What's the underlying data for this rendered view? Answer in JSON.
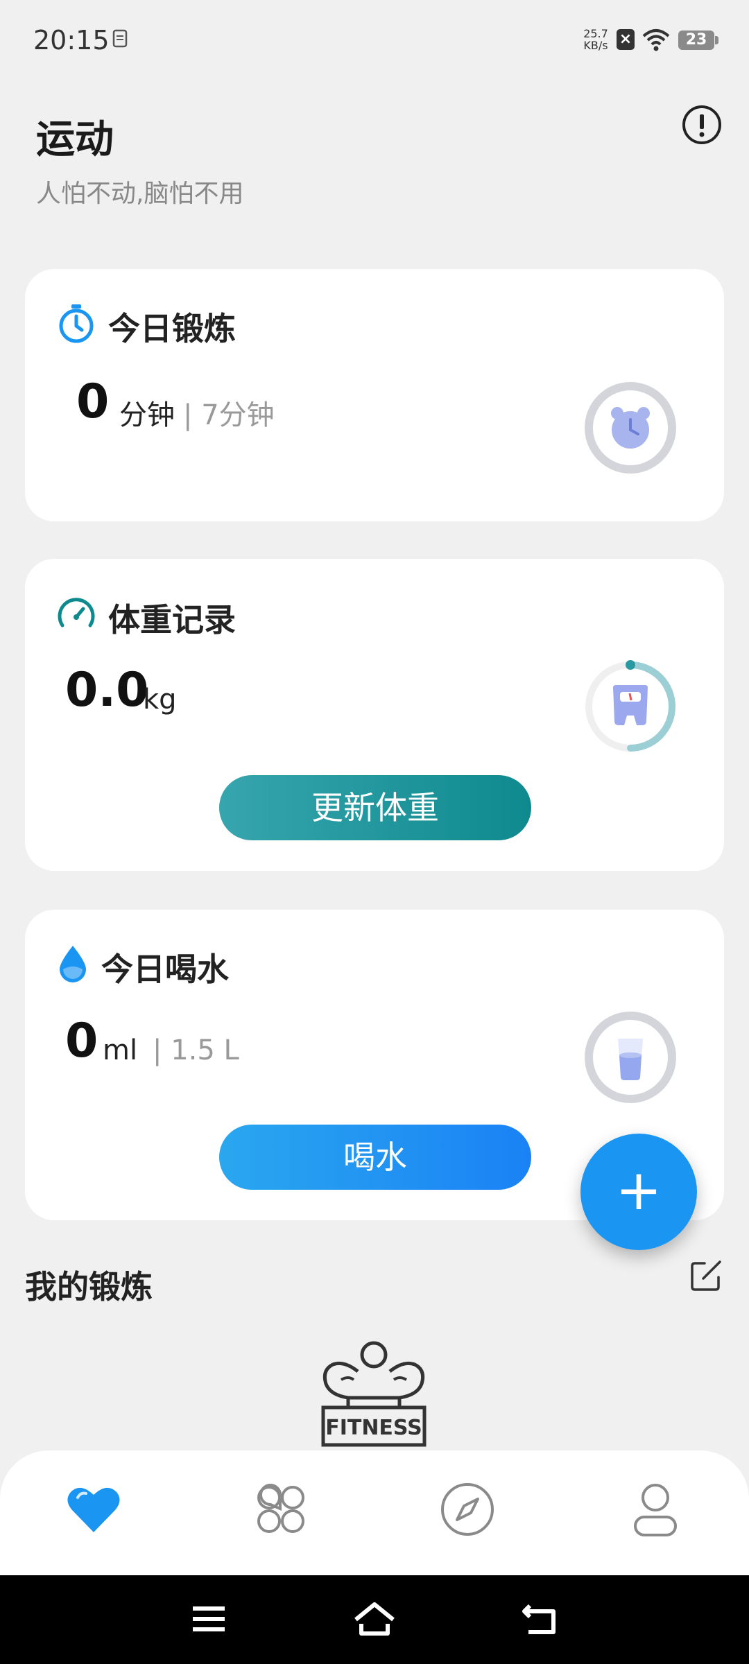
{
  "status_bar": {
    "time": "20:15",
    "net_speed_value": "25.7",
    "net_speed_unit": "KB/s",
    "battery": "23",
    "icons": [
      "document-icon",
      "x-box-icon",
      "wifi-icon",
      "battery-icon"
    ]
  },
  "header": {
    "title": "运动",
    "subtitle": "人怕不动,脑怕不用",
    "info_icon": "info-icon"
  },
  "exercise_card": {
    "title": "今日锻炼",
    "value": "0",
    "unit": "分钟",
    "goal": "| 7分钟",
    "icon": "timer-icon",
    "ring_icon": "alarm-clock-icon"
  },
  "weight_card": {
    "title": "体重记录",
    "value": "0.0",
    "unit": "kg",
    "button": "更新体重",
    "icon": "gauge-icon",
    "ring_icon": "scale-icon",
    "ring_progress": 0.5
  },
  "water_card": {
    "title": "今日喝水",
    "value": "0",
    "unit": "ml",
    "goal": "| 1.5 L",
    "button": "喝水",
    "icon": "water-drop-icon",
    "ring_icon": "glass-icon"
  },
  "fab": {
    "label": "+"
  },
  "my_exercise": {
    "title": "我的锻炼",
    "logo_text": "FITNESS"
  },
  "bottom_nav": {
    "items": [
      "heart-icon",
      "apps-icon",
      "compass-icon",
      "profile-icon"
    ],
    "active": 0
  },
  "colors": {
    "accent_blue": "#1a96f2",
    "teal": "#0e8a8e",
    "background": "#f0f0f0"
  }
}
